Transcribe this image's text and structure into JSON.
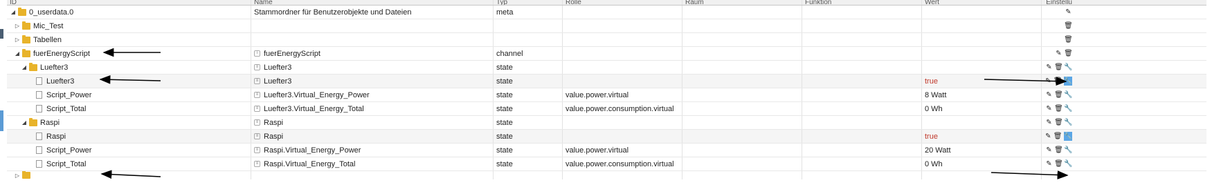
{
  "columns": {
    "id": "ID",
    "name": "Name",
    "typ": "Typ",
    "rolle": "Rolle",
    "raum": "Raum",
    "funktion": "Funktion",
    "wert": "Wert",
    "einstellung": "Einstellu"
  },
  "rows": [
    {
      "id": "0_userdata.0",
      "name": "Stammordner für Benutzerobjekte und Dateien",
      "typ": "meta",
      "rolle": "",
      "wert": ""
    },
    {
      "id": "Mic_Test",
      "name": "",
      "typ": "",
      "rolle": "",
      "wert": ""
    },
    {
      "id": "Tabellen",
      "name": "",
      "typ": "",
      "rolle": "",
      "wert": ""
    },
    {
      "id": "fuerEnergyScript",
      "name": "fuerEnergyScript",
      "typ": "channel",
      "rolle": "",
      "wert": ""
    },
    {
      "id": "Luefter3",
      "name": "Luefter3",
      "typ": "state",
      "rolle": "",
      "wert": ""
    },
    {
      "id": "Luefter3",
      "name": "Luefter3",
      "typ": "state",
      "rolle": "",
      "wert": "true"
    },
    {
      "id": "Script_Power",
      "name": "Luefter3.Virtual_Energy_Power",
      "typ": "state",
      "rolle": "value.power.virtual",
      "wert": "8 Watt"
    },
    {
      "id": "Script_Total",
      "name": "Luefter3.Virtual_Energy_Total",
      "typ": "state",
      "rolle": "value.power.consumption.virtual",
      "wert": "0 Wh"
    },
    {
      "id": "Raspi",
      "name": "Raspi",
      "typ": "state",
      "rolle": "",
      "wert": ""
    },
    {
      "id": "Raspi",
      "name": "Raspi",
      "typ": "state",
      "rolle": "",
      "wert": "true"
    },
    {
      "id": "Script_Power",
      "name": "Raspi.Virtual_Energy_Power",
      "typ": "state",
      "rolle": "value.power.virtual",
      "wert": "20 Watt"
    },
    {
      "id": "Script_Total",
      "name": "Raspi.Virtual_Energy_Total",
      "typ": "state",
      "rolle": "value.power.consumption.virtual",
      "wert": "0 Wh"
    }
  ],
  "icons": {
    "edit": "pencil-icon",
    "delete": "trash-icon",
    "settings": "wrench-icon",
    "folder": "folder-icon",
    "file": "file-icon",
    "arrow": "arrow-annotation"
  },
  "colors": {
    "value_true": "#c0392b",
    "folder": "#e8b32a",
    "active_button": "#5aa6e6"
  }
}
